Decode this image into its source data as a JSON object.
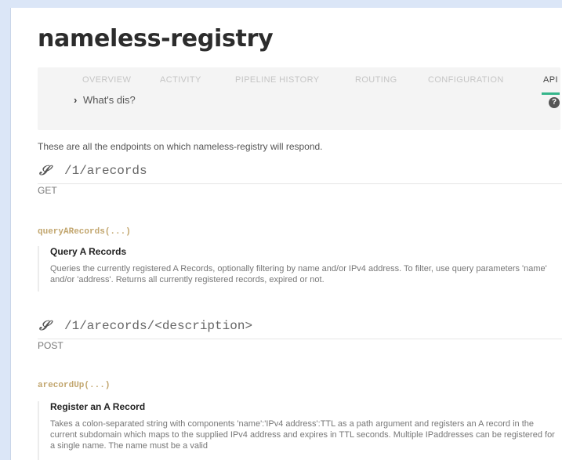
{
  "page": {
    "title": "nameless-registry"
  },
  "tabs": [
    {
      "label": "OVERVIEW",
      "active": false
    },
    {
      "label": "ACTIVITY",
      "active": false
    },
    {
      "label": "PIPELINE HISTORY",
      "active": false
    },
    {
      "label": "ROUTING",
      "active": false
    },
    {
      "label": "CONFIGURATION",
      "active": false
    },
    {
      "label": "API",
      "active": true
    }
  ],
  "accent_color": "#35b58a",
  "help": {
    "label": "What's dis?",
    "icon": "question-circle-icon"
  },
  "intro": "These are all the endpoints on which nameless-registry will respond.",
  "endpoints": [
    {
      "path": "/1/arecords",
      "method": "GET",
      "function": "queryARecords(...)",
      "doc_title": "Query A Records",
      "doc_body": "Queries the currently registered A Records, optionally filtering by name and/or IPv4 address. To filter, use query parameters 'name' and/or 'address'. Returns all currently registered records, expired or not."
    },
    {
      "path": "/1/arecords/<description>",
      "method": "POST",
      "function": "arecordUp(...)",
      "doc_title": "Register an A Record",
      "doc_body": "Takes a colon-separated string with components 'name':'IPv4 address':TTL as a path argument and registers an A record in the current subdomain which maps to the supplied IPv4 address and expires in TTL seconds. Multiple IPaddresses can be registered for a single name. The name must be a valid"
    }
  ]
}
